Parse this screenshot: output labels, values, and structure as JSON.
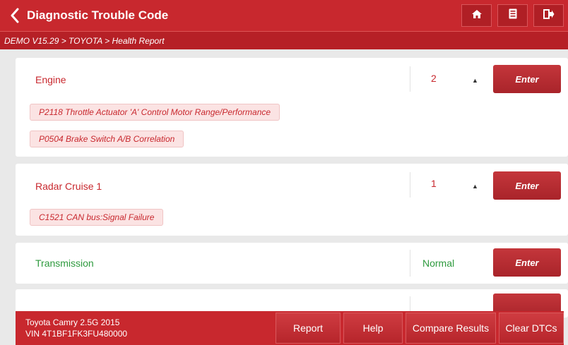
{
  "header": {
    "title": "Diagnostic Trouble Code",
    "breadcrumb": "DEMO V15.29 > TOYOTA > Health Report",
    "accent_color": "#c8282e"
  },
  "systems": [
    {
      "name": "Engine",
      "status": "2",
      "status_color": "#c8282e",
      "enter_label": "Enter",
      "dtcs": [
        "P2118 Throttle Actuator 'A' Control Motor Range/Performance",
        "P0504 Brake Switch A/B Correlation"
      ]
    },
    {
      "name": "Radar Cruise 1",
      "status": "1",
      "status_color": "#c8282e",
      "enter_label": "Enter",
      "dtcs": [
        "C1521 CAN bus:Signal Failure"
      ]
    },
    {
      "name": "Transmission",
      "status": "Normal",
      "status_color": "#2e9a3e",
      "enter_label": "Enter",
      "dtcs": []
    }
  ],
  "footer": {
    "vehicle_model": "Toyota Camry 2.5G 2015",
    "vin": "VIN 4T1BF1FK3FU480000",
    "buttons": {
      "report": "Report",
      "help": "Help",
      "compare": "Compare Results",
      "clear": "Clear DTCs"
    }
  },
  "icons": [
    "back-arrow-icon",
    "home-icon",
    "save-icon",
    "exit-icon",
    "collapse-caret-icon"
  ]
}
